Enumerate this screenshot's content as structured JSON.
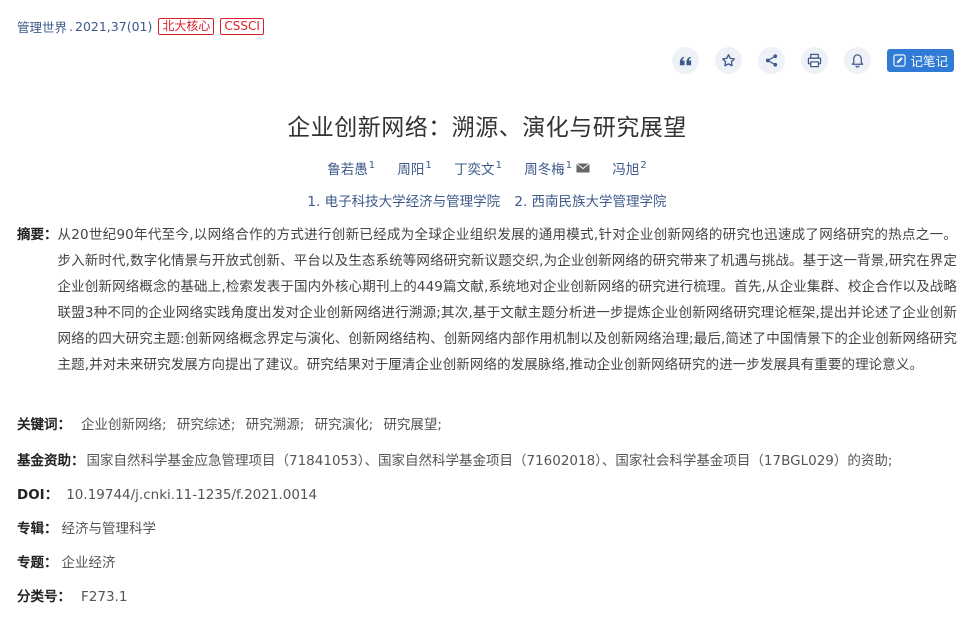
{
  "header": {
    "journal": "管理世界",
    "separator": ".",
    "issue": "2021,37(01)",
    "tags": [
      "北大核心",
      "CSSCI"
    ]
  },
  "toolbar": {
    "icons": [
      "quote-icon",
      "star-icon",
      "share-icon",
      "print-icon",
      "bell-icon"
    ],
    "note_label": "记笔记",
    "accent_color": "#2f7bd6"
  },
  "article": {
    "title": "企业创新网络：溯源、演化与研究展望",
    "authors": [
      {
        "name": "鲁若愚",
        "aff": "1"
      },
      {
        "name": "周阳",
        "aff": "1"
      },
      {
        "name": "丁奕文",
        "aff": "1"
      },
      {
        "name": "周冬梅",
        "aff": "1"
      },
      {
        "name": "冯旭",
        "aff": "2"
      }
    ],
    "affiliations": [
      "1. 电子科技大学经济与管理学院",
      "2. 西南民族大学管理学院"
    ],
    "abstract_label": "摘要：",
    "abstract": "从20世纪90年代至今,以网络合作的方式进行创新已经成为全球企业组织发展的通用模式,针对企业创新网络的研究也迅速成了网络研究的热点之一。步入新时代,数字化情景与开放式创新、平台以及生态系统等网络研究新议题交织,为企业创新网络的研究带来了机遇与挑战。基于这一背景,研究在界定企业创新网络概念的基础上,检索发表于国内外核心期刊上的449篇文献,系统地对企业创新网络的研究进行梳理。首先,从企业集群、校企合作以及战略联盟3种不同的企业网络实践角度出发对企业创新网络进行溯源;其次,基于文献主题分析进一步提炼企业创新网络研究理论框架,提出并论述了企业创新网络的四大研究主题:创新网络概念界定与演化、创新网络结构、创新网络内部作用机制以及创新网络治理;最后,简述了中国情景下的企业创新网络研究主题,并对未来研究发展方向提出了建议。研究结果对于厘清企业创新网络的发展脉络,推动企业创新网络研究的进一步发展具有重要的理论意义。",
    "keywords_label": "关键词：",
    "keywords": [
      "企业创新网络;",
      "研究综述;",
      "研究溯源;",
      "研究演化;",
      "研究展望;"
    ],
    "fund_label": "基金资助：",
    "fund": "国家自然科学基金应急管理项目（71841053）、国家自然科学基金项目（71602018）、国家社会科学基金项目（17BGL029）的资助;",
    "doi_label": "DOI：",
    "doi": "10.19744/j.cnki.11-1235/f.2021.0014",
    "series_label": "专辑：",
    "series": "经济与管理科学",
    "topic_label": "专题：",
    "topic": "企业经济",
    "class_label": "分类号：",
    "class": "F273.1"
  }
}
